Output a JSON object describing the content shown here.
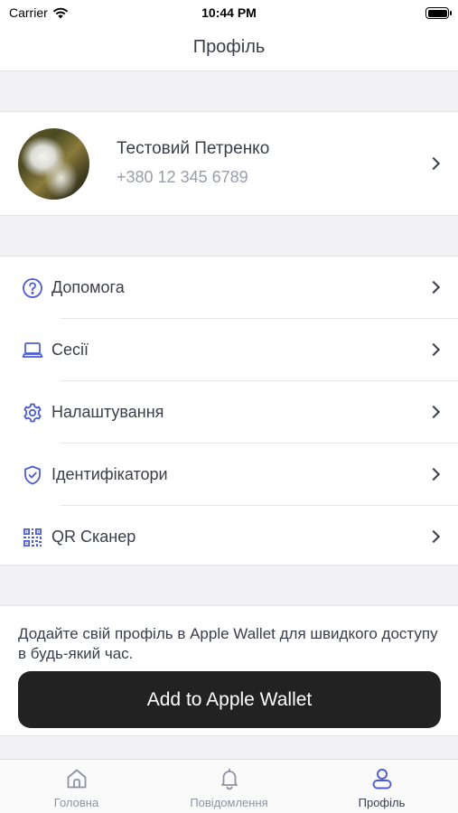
{
  "status_bar": {
    "carrier": "Carrier",
    "time": "10:44 PM"
  },
  "header": {
    "title": "Профіль"
  },
  "profile": {
    "name": "Тестовий Петренко",
    "phone": "+380 12 345 6789"
  },
  "menu": [
    {
      "label": "Допомога",
      "icon": "help-circle-icon"
    },
    {
      "label": "Сесії",
      "icon": "laptop-icon"
    },
    {
      "label": "Налаштування",
      "icon": "gear-icon"
    },
    {
      "label": "Ідентифікатори",
      "icon": "shield-check-icon"
    },
    {
      "label": "QR Сканер",
      "icon": "qr-code-icon"
    }
  ],
  "wallet": {
    "description": "Додайте свій профіль в Apple Wallet для швидкого доступу в будь-який час.",
    "button_label": "Add to Apple Wallet"
  },
  "tabs": [
    {
      "label": "Головна",
      "icon": "home-icon"
    },
    {
      "label": "Повідомлення",
      "icon": "bell-icon"
    },
    {
      "label": "Профіль",
      "icon": "user-icon",
      "active": true
    }
  ],
  "colors": {
    "accent": "#4a5cd6",
    "text": "#3a3d4a",
    "muted": "#9a9daa",
    "button": "#222222"
  }
}
